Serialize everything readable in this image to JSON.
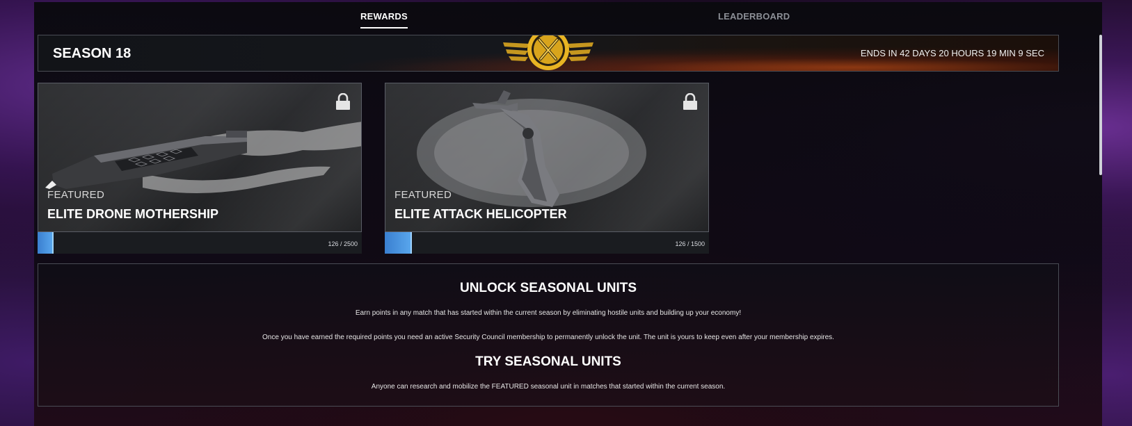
{
  "tabs": [
    {
      "label": "REWARDS",
      "active": true
    },
    {
      "label": "LEADERBOARD",
      "active": false
    }
  ],
  "season": {
    "title": "SEASON 18",
    "ends": "ENDS IN 42 DAYS 20 HOURS 19 MIN 9 SEC",
    "emblem_icon": "crossed-swords-emblem-icon"
  },
  "cards": [
    {
      "tag": "FEATURED",
      "name": "ELITE DRONE MOTHERSHIP",
      "locked": true,
      "progress_text": "126 / 2500",
      "progress_value": 126,
      "progress_max": 2500
    },
    {
      "tag": "FEATURED",
      "name": "ELITE ATTACK HELICOPTER",
      "locked": true,
      "progress_text": "126 / 1500",
      "progress_value": 126,
      "progress_max": 1500
    }
  ],
  "info": {
    "unlock_heading": "UNLOCK SEASONAL UNITS",
    "unlock_p1": "Earn points in any match that has started within the current season by eliminating hostile units and building up your economy!",
    "unlock_p2": "Once you have earned the required points you need an active Security Council membership to permanently unlock the unit. The unit is yours to keep even after your membership expires.",
    "try_heading": "TRY SEASONAL UNITS",
    "try_p1": "Anyone can research and mobilize the FEATURED seasonal unit in matches that started within the current season."
  },
  "colors": {
    "progress_fill": "#4a95e0",
    "emblem_gold": "#e8b423"
  }
}
